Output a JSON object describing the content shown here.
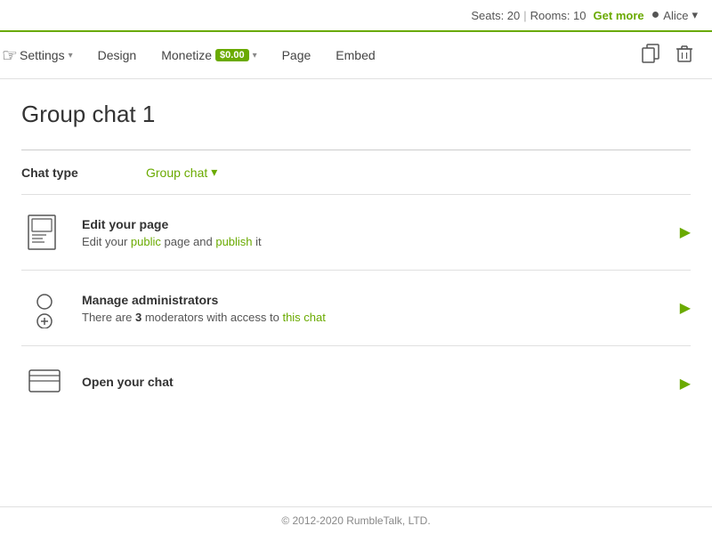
{
  "topbar": {
    "seats_label": "Seats: 20",
    "separator1": "|",
    "rooms_label": "Rooms: 10",
    "get_more_label": "Get more",
    "user_name": "Alice",
    "dropdown_arrow": "▾"
  },
  "navbar": {
    "items": [
      {
        "id": "settings",
        "label": "Settings",
        "has_arrow": true
      },
      {
        "id": "design",
        "label": "Design",
        "has_arrow": false
      },
      {
        "id": "monetize",
        "label": "Monetize",
        "has_arrow": true,
        "badge": "$0.00"
      },
      {
        "id": "page",
        "label": "Page",
        "has_arrow": false
      },
      {
        "id": "embed",
        "label": "Embed",
        "has_arrow": false
      }
    ],
    "copy_icon": "⧉",
    "delete_icon": "🗑"
  },
  "page": {
    "title": "Group chat 1"
  },
  "chat_type": {
    "label": "Chat type",
    "value": "Group chat",
    "dropdown_arrow": "▾"
  },
  "list_items": [
    {
      "id": "edit-page",
      "title": "Edit your page",
      "description": "Edit your public page and publish it",
      "desc_highlight_word": "public",
      "desc_highlight_word2": "publish"
    },
    {
      "id": "manage-admins",
      "title": "Manage administrators",
      "description_parts": [
        "There are ",
        "3",
        " moderators with access to ",
        "this chat"
      ],
      "description_highlight": "this chat"
    },
    {
      "id": "open-chat",
      "title": "Open your chat",
      "description": ""
    }
  ],
  "footer": {
    "text": "© 2012-2020 RumbleTalk, LTD."
  }
}
